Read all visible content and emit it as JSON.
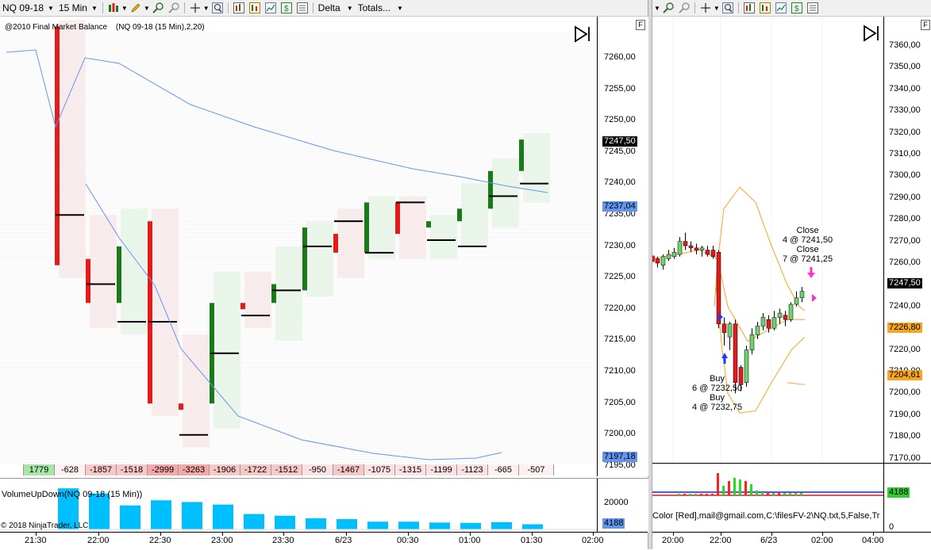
{
  "toolbar_left": {
    "instrument": "NQ 09-18",
    "interval": "15 Min",
    "delta_label": "Delta",
    "totals_label": "Totals..."
  },
  "left_chart": {
    "indicator_label": "@2010 Final Market Balance",
    "series_label": "(NQ 09-18 (15 Min),2,20)",
    "price_labels": [
      "7260,00",
      "7255,00",
      "7250,00",
      "7245,00",
      "7240,00",
      "7235,00",
      "7230,00",
      "7225,00",
      "7220,00",
      "7215,00",
      "7210,00",
      "7205,00",
      "7200,00",
      "7195,00"
    ],
    "last_price": "7247,50",
    "tag_blue_upper": "7237,04",
    "tag_blue_lower": "7197,18",
    "delta_values": [
      "1779",
      "-628",
      "-1857",
      "-1518",
      "-2999",
      "-3263",
      "-1906",
      "-1722",
      "-1512",
      "-950",
      "-1467",
      "-1075",
      "-1315",
      "-1199",
      "-1123",
      "-665",
      "-507"
    ],
    "volume_label": "VolumeUpDown(NQ 09-18 (15 Min))",
    "volume_axis": "20000",
    "volume_tag": "4188",
    "copyright": "© 2018 NinjaTrader, LLC",
    "time_labels": [
      "21:30",
      "22:00",
      "22:30",
      "23:00",
      "23:30",
      "6/23",
      "00:30",
      "01:00",
      "01:30",
      "02:00"
    ],
    "panel_flag": "F"
  },
  "right_chart": {
    "price_labels": [
      "7360,00",
      "7350,00",
      "7340,00",
      "7330,00",
      "7320,00",
      "7310,00",
      "7300,00",
      "7290,00",
      "7280,00",
      "7270,00",
      "7260,00",
      "7250,00",
      "7240,00",
      "7230,00",
      "7220,00",
      "7210,00",
      "7200,00",
      "7190,00",
      "7180,00",
      "7170,00"
    ],
    "last_price": "7247,50",
    "tag_orange_1": "7226,80",
    "tag_orange_2": "7204,61",
    "annotations": {
      "close1_a": "Close",
      "close1_b": "4 @ 7241,50",
      "close2_a": "Close",
      "close2_b": "7 @ 7241,25",
      "buy1_a": "Buy",
      "buy1_b": "6 @ 7232,50",
      "buy2_a": "Buy",
      "buy2_b": "4 @ 7232,75"
    },
    "volume_tag": "4188",
    "status_text": "Color [Red],mail@gmail.com,C:\\filesFV-2\\NQ.txt,5,False,Tr",
    "volume_axis": "0",
    "time_labels": [
      "20:00",
      "22:00",
      "6/23",
      "02:00",
      "04:00"
    ],
    "panel_flag": "F"
  },
  "colors": {
    "bull": "#1a7a1a",
    "bear": "#e31b1b",
    "volume_bar": "#00bfff",
    "band": "#f5a623",
    "vwap_line": "#6495ed",
    "delta_positive": "#c8f0c8",
    "delta_negative": "#f5c8c8"
  }
}
